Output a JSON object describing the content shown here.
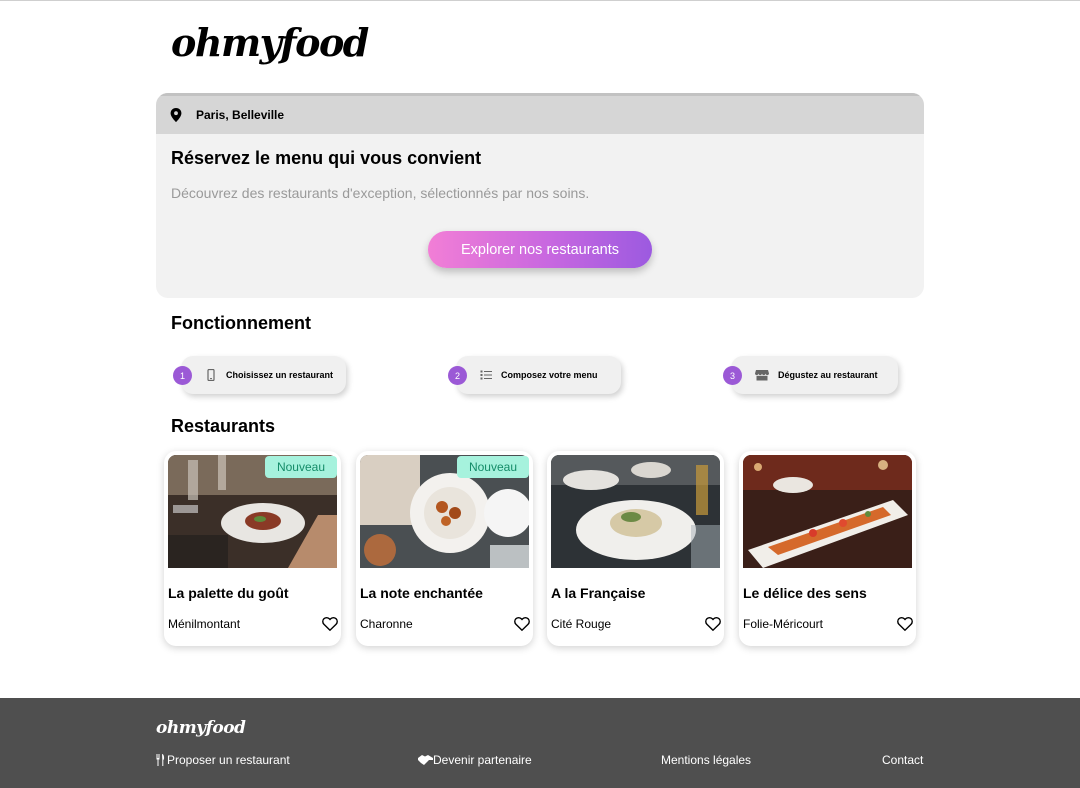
{
  "header": {
    "logo": "ohmyfood"
  },
  "hero": {
    "location": "Paris, Belleville",
    "title": "Réservez le menu qui vous convient",
    "subtitle": "Découvrez des restaurants d'exception, sélectionnés par nos soins.",
    "cta_label": "Explorer nos restaurants"
  },
  "steps": {
    "title": "Fonctionnement",
    "items": [
      {
        "number": "1",
        "icon": "mobile-icon",
        "label": "Choisissez un restaurant"
      },
      {
        "number": "2",
        "icon": "list-icon",
        "label": "Composez votre menu"
      },
      {
        "number": "3",
        "icon": "store-icon",
        "label": "Dégustez au restaurant"
      }
    ]
  },
  "restaurants": {
    "title": "Restaurants",
    "items": [
      {
        "name": "La palette du goût",
        "location": "Ménilmontant",
        "badge": "Nouveau"
      },
      {
        "name": "La note enchantée",
        "location": "Charonne",
        "badge": "Nouveau"
      },
      {
        "name": "A la Française",
        "location": "Cité Rouge",
        "badge": ""
      },
      {
        "name": "Le délice des sens",
        "location": "Folie-Méricourt",
        "badge": ""
      }
    ]
  },
  "footer": {
    "logo": "ohmyfood",
    "links": [
      {
        "label": "Proposer un restaurant",
        "icon": "utensils-icon"
      },
      {
        "label": "Devenir partenaire",
        "icon": "handshake-icon"
      },
      {
        "label": "Mentions légales",
        "icon": ""
      },
      {
        "label": "Contact",
        "icon": ""
      }
    ]
  },
  "colors": {
    "accent_pink": "#f27ed6",
    "accent_purple": "#9c5ae0",
    "badge_bg": "#a6f2dd",
    "badge_text": "#148c68",
    "footer_bg": "#4f4f4f"
  }
}
